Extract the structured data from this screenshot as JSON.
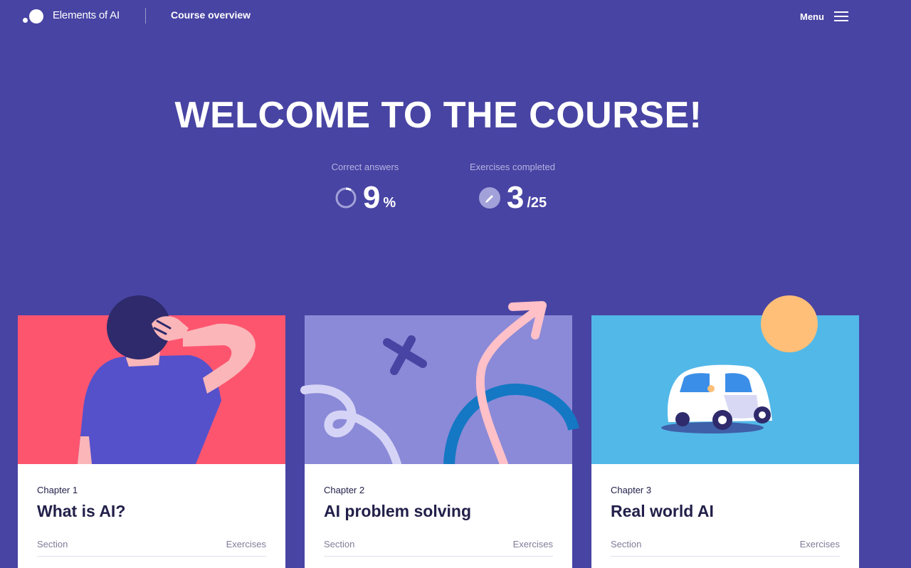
{
  "header": {
    "brand": "Elements of AI",
    "nav_course": "Course overview",
    "menu_label": "Menu"
  },
  "hero": {
    "title": "WELCOME TO THE COURSE!"
  },
  "stats": {
    "correct": {
      "label": "Correct answers",
      "value": "9",
      "unit": "%",
      "progress": 0.09
    },
    "exercises": {
      "label": "Exercises completed",
      "value": "3",
      "unit": "/25",
      "done": 3,
      "total": 25
    }
  },
  "chapters": [
    {
      "kicker": "Chapter 1",
      "title": "What is AI?",
      "col_section": "Section",
      "col_exercises": "Exercises"
    },
    {
      "kicker": "Chapter 2",
      "title": "AI problem solving",
      "col_section": "Section",
      "col_exercises": "Exercises"
    },
    {
      "kicker": "Chapter 3",
      "title": "Real world AI",
      "col_section": "Section",
      "col_exercises": "Exercises"
    }
  ],
  "colors": {
    "background": "#4844a3",
    "card1": "#fe556f",
    "card2": "#8b8ad8",
    "card3": "#52b8e8",
    "text_dark": "#22204a"
  },
  "icons": {
    "logo": "elements-of-ai-logo",
    "menu": "hamburger-icon",
    "correct": "progress-ring-icon",
    "exercises": "pencil-icon"
  }
}
